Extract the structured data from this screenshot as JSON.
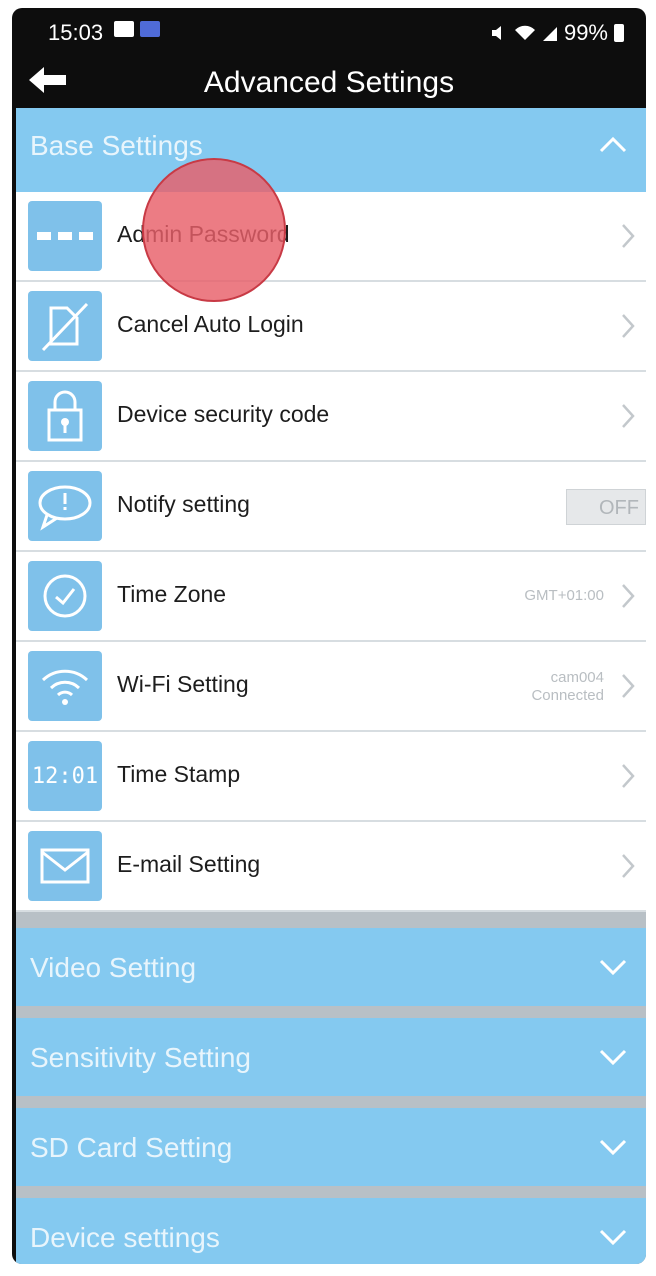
{
  "status_bar": {
    "time": "15:03",
    "battery": "99%"
  },
  "header": {
    "title": "Advanced Settings"
  },
  "base_settings": {
    "label": "Base Settings",
    "items": [
      {
        "label": "Admin Password",
        "icon": "password-dots-icon"
      },
      {
        "label": "Cancel Auto Login",
        "icon": "cancel-login-icon"
      },
      {
        "label": "Device security code",
        "icon": "lock-icon"
      },
      {
        "label": "Notify setting",
        "icon": "speech-bubble-icon",
        "toggle": "OFF"
      },
      {
        "label": "Time Zone",
        "icon": "clock-icon",
        "value": "GMT+01:00"
      },
      {
        "label": "Wi-Fi Setting",
        "icon": "wifi-icon",
        "value_line1": "cam004",
        "value_line2": "Connected"
      },
      {
        "label": "Time Stamp",
        "icon": "digital-clock-icon",
        "icon_text": "12:01"
      },
      {
        "label": "E-mail Setting",
        "icon": "envelope-icon"
      }
    ]
  },
  "collapsed_sections": [
    {
      "label": "Video Setting"
    },
    {
      "label": "Sensitivity Setting"
    },
    {
      "label": "SD Card Setting"
    },
    {
      "label": "Device settings"
    }
  ],
  "colors": {
    "accent": "#84c9f0",
    "icon_tile": "#7fc1ea",
    "tap_indicator": "#e85f69"
  }
}
